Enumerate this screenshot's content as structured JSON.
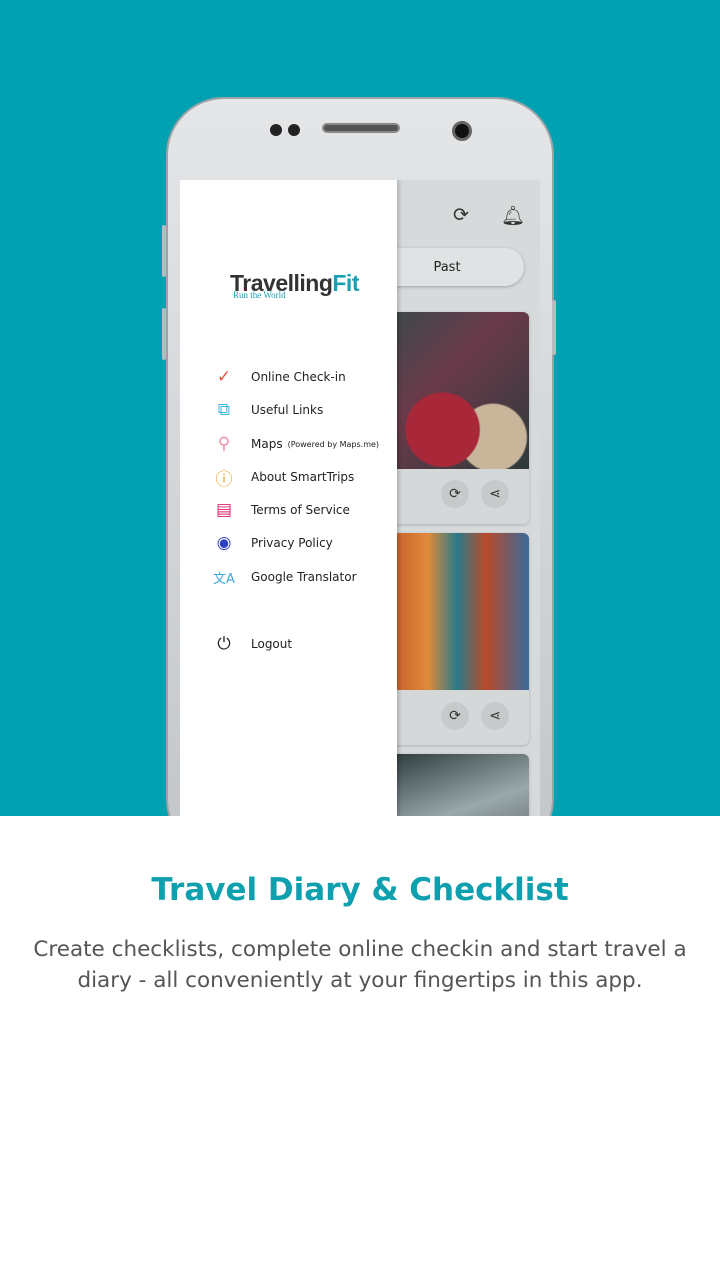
{
  "colors": {
    "background": "#00a2b1",
    "accent": "#0ea0ae"
  },
  "app": {
    "logo": {
      "text_main": "Travelling",
      "text_accent": "Fit",
      "tagline": "Run the World"
    },
    "header_icons": [
      "refresh-icon",
      "bell-icon"
    ],
    "tab_label": "Past",
    "menu": [
      {
        "label": "Online Check-in",
        "icon": "location-check-icon",
        "color": "#e2553b"
      },
      {
        "label": "Useful Links",
        "icon": "links-icon",
        "color": "#3cb4e0"
      },
      {
        "label": "Maps",
        "sub": "(Powered by Maps.me)",
        "icon": "map-pin-icon",
        "color": "#f08fa6"
      },
      {
        "label": "About SmartTrips",
        "icon": "info-icon",
        "color": "#f0a21e"
      },
      {
        "label": "Terms of Service",
        "icon": "document-icon",
        "color": "#e0226a"
      },
      {
        "label": "Privacy Policy",
        "icon": "eye-icon",
        "color": "#2f3fc4"
      },
      {
        "label": "Google Translator",
        "icon": "translate-icon",
        "color": "#3aa8d8"
      }
    ],
    "logout": {
      "label": "Logout",
      "icon": "power-icon"
    }
  },
  "promo": {
    "title": "Travel Diary & Checklist",
    "description": "Create checklists, complete online checkin and start travel a diary - all conveniently at your fingertips in this app."
  }
}
